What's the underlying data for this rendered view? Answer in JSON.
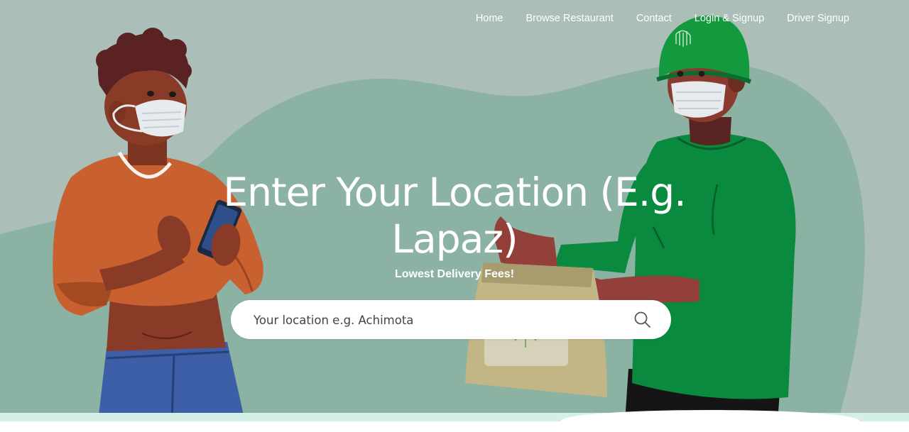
{
  "nav": {
    "items": [
      {
        "label": "Home"
      },
      {
        "label": "Browse Restaurant"
      },
      {
        "label": "Contact"
      },
      {
        "label": "Login & Signup"
      },
      {
        "label": "Driver Signup"
      }
    ]
  },
  "hero": {
    "headline": "Enter Your Location (E.g. Lapaz)",
    "subline": "Lowest Delivery Fees!",
    "search_placeholder": "Your location e.g. Achimota",
    "search_icon": "search-icon",
    "illustration": "customer-receiving-delivery-from-courier"
  },
  "colors": {
    "background": "#abbfb8",
    "blob": "#8bb2a2",
    "courier_green": "#0a8a3f",
    "white": "#ffffff"
  }
}
